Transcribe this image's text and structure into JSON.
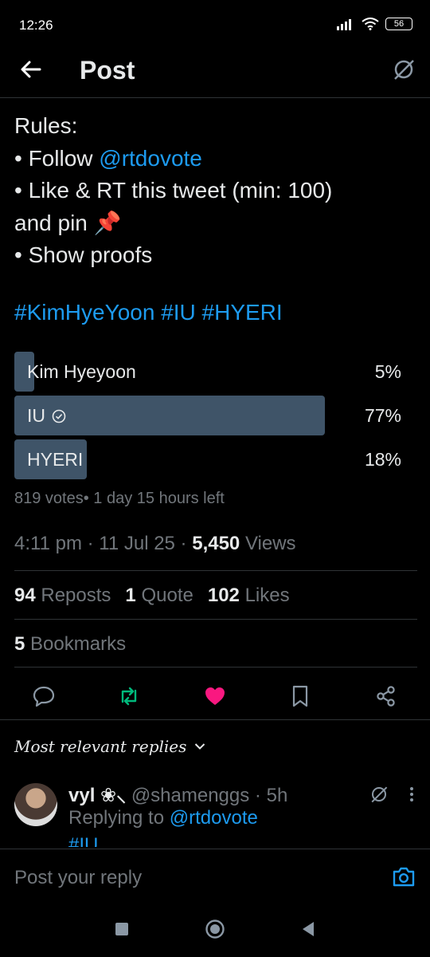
{
  "status": {
    "time": "12:26",
    "battery": "56"
  },
  "header": {
    "title": "Post"
  },
  "tweet": {
    "line1": "Rules:",
    "line2_prefix": "• Follow ",
    "line2_mention": "@rtdovote",
    "line3": "• Like & RT this tweet (min: 100)",
    "line4": "and pin 📌",
    "line5": "• Show proofs",
    "hashtags": "#KimHyeYoon #IU #HYERI"
  },
  "poll": {
    "options": [
      {
        "label": "Kim Hyeyoon",
        "percent": "5%",
        "fill": 0.05
      },
      {
        "label": "IU",
        "percent": "77%",
        "fill": 0.77,
        "winner": true
      },
      {
        "label": "HYERI",
        "percent": "18%",
        "fill": 0.18
      }
    ],
    "votes": "819 votes",
    "time_left": "1 day 15 hours left"
  },
  "meta": {
    "time": "4:11 pm",
    "date": "11 Jul 25",
    "views_count": "5,450",
    "views_label": "Views"
  },
  "stats": {
    "reposts_count": "94",
    "reposts_label": "Reposts",
    "quotes_count": "1",
    "quotes_label": "Quote",
    "likes_count": "102",
    "likes_label": "Likes",
    "bookmarks_count": "5",
    "bookmarks_label": "Bookmarks"
  },
  "replies": {
    "header": "Most relevant replies",
    "first": {
      "name": "vyl ❀⸜",
      "handle": "@shamenggs",
      "age": "5h",
      "replying_prefix": "Replying to ",
      "replying_to": "@rtdovote",
      "text": "#IU"
    }
  },
  "composer": {
    "placeholder": "Post your reply"
  },
  "colors": {
    "accent": "#1d9bf0",
    "like": "#f91880",
    "repost": "#00ba7c",
    "poll_bar": "#3f5468"
  }
}
